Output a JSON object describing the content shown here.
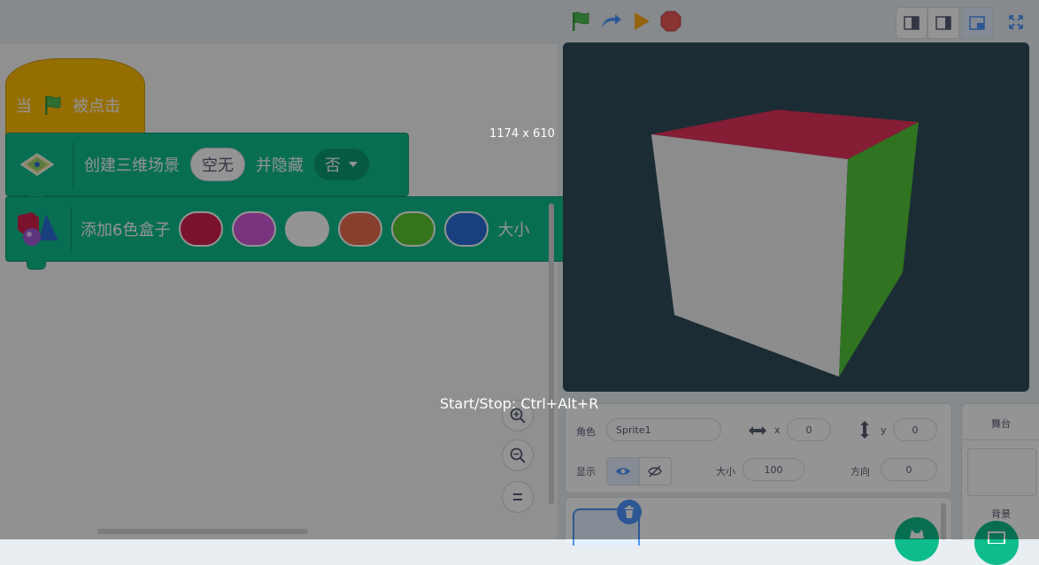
{
  "workspace": {
    "hat_block": {
      "when_label": "当",
      "clicked_label": "被点击"
    },
    "create_block": {
      "label": "创建三维场景",
      "scene_value": "空无",
      "hide_label": "并隐藏",
      "hide_value": "否"
    },
    "box_block": {
      "label": "添加6色盒子",
      "colors": [
        "#d1224a",
        "#d15ad8",
        "#ffffff",
        "#ea6f4f",
        "#5ec633",
        "#2b6fd9"
      ],
      "size_label": "大小"
    }
  },
  "stage": {
    "background": "#2f4c5a",
    "cube_colors": {
      "top": "#e6325a",
      "front": "#f2f2f2",
      "right": "#54c73a"
    }
  },
  "sprite_info": {
    "sprite_label": "角色",
    "sprite_name": "Sprite1",
    "x_label": "x",
    "x_value": "0",
    "y_label": "y",
    "y_value": "0",
    "show_label": "显示",
    "size_label": "大小",
    "size_value": "100",
    "direction_label": "方向",
    "direction_value": "0"
  },
  "stage_panel": {
    "title": "舞台",
    "backdrop_label": "背景"
  },
  "overlay": {
    "dimensions_text": "1174 x 610",
    "shortcut_text": "Start/Stop: Ctrl+Alt+R"
  },
  "colors": {
    "accent_green": "#0fbd8c",
    "hat_yellow": "#ffbf00",
    "blue_ui": "#4c97ff"
  }
}
